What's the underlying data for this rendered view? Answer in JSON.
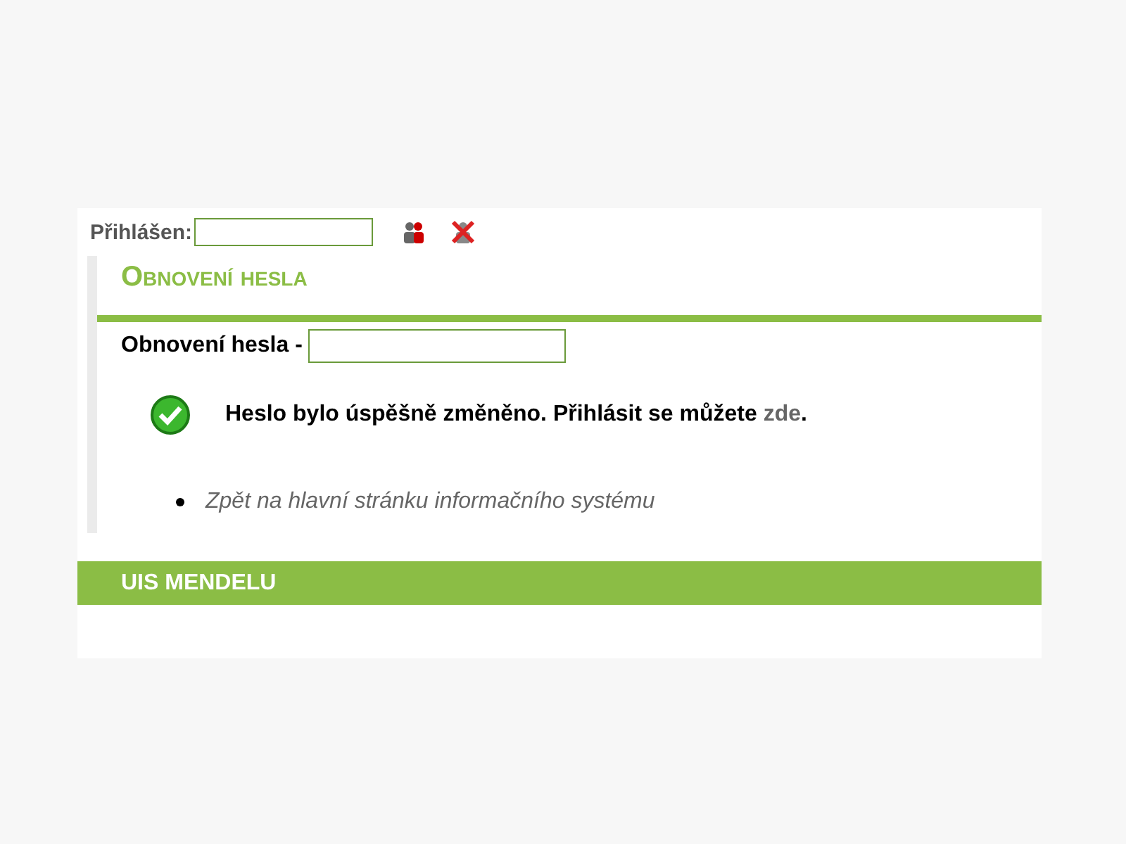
{
  "login": {
    "label": "Přihlášen:"
  },
  "heading": "Obnovení hesla",
  "form": {
    "label": "Obnovení hesla -"
  },
  "message": {
    "text": "Heslo bylo úspěšně změněno. Přihlásit se můžete ",
    "link": "zde",
    "end": "."
  },
  "links": [
    "Zpět na hlavní stránku informačního systému"
  ],
  "footer": "UIS MENDELU"
}
